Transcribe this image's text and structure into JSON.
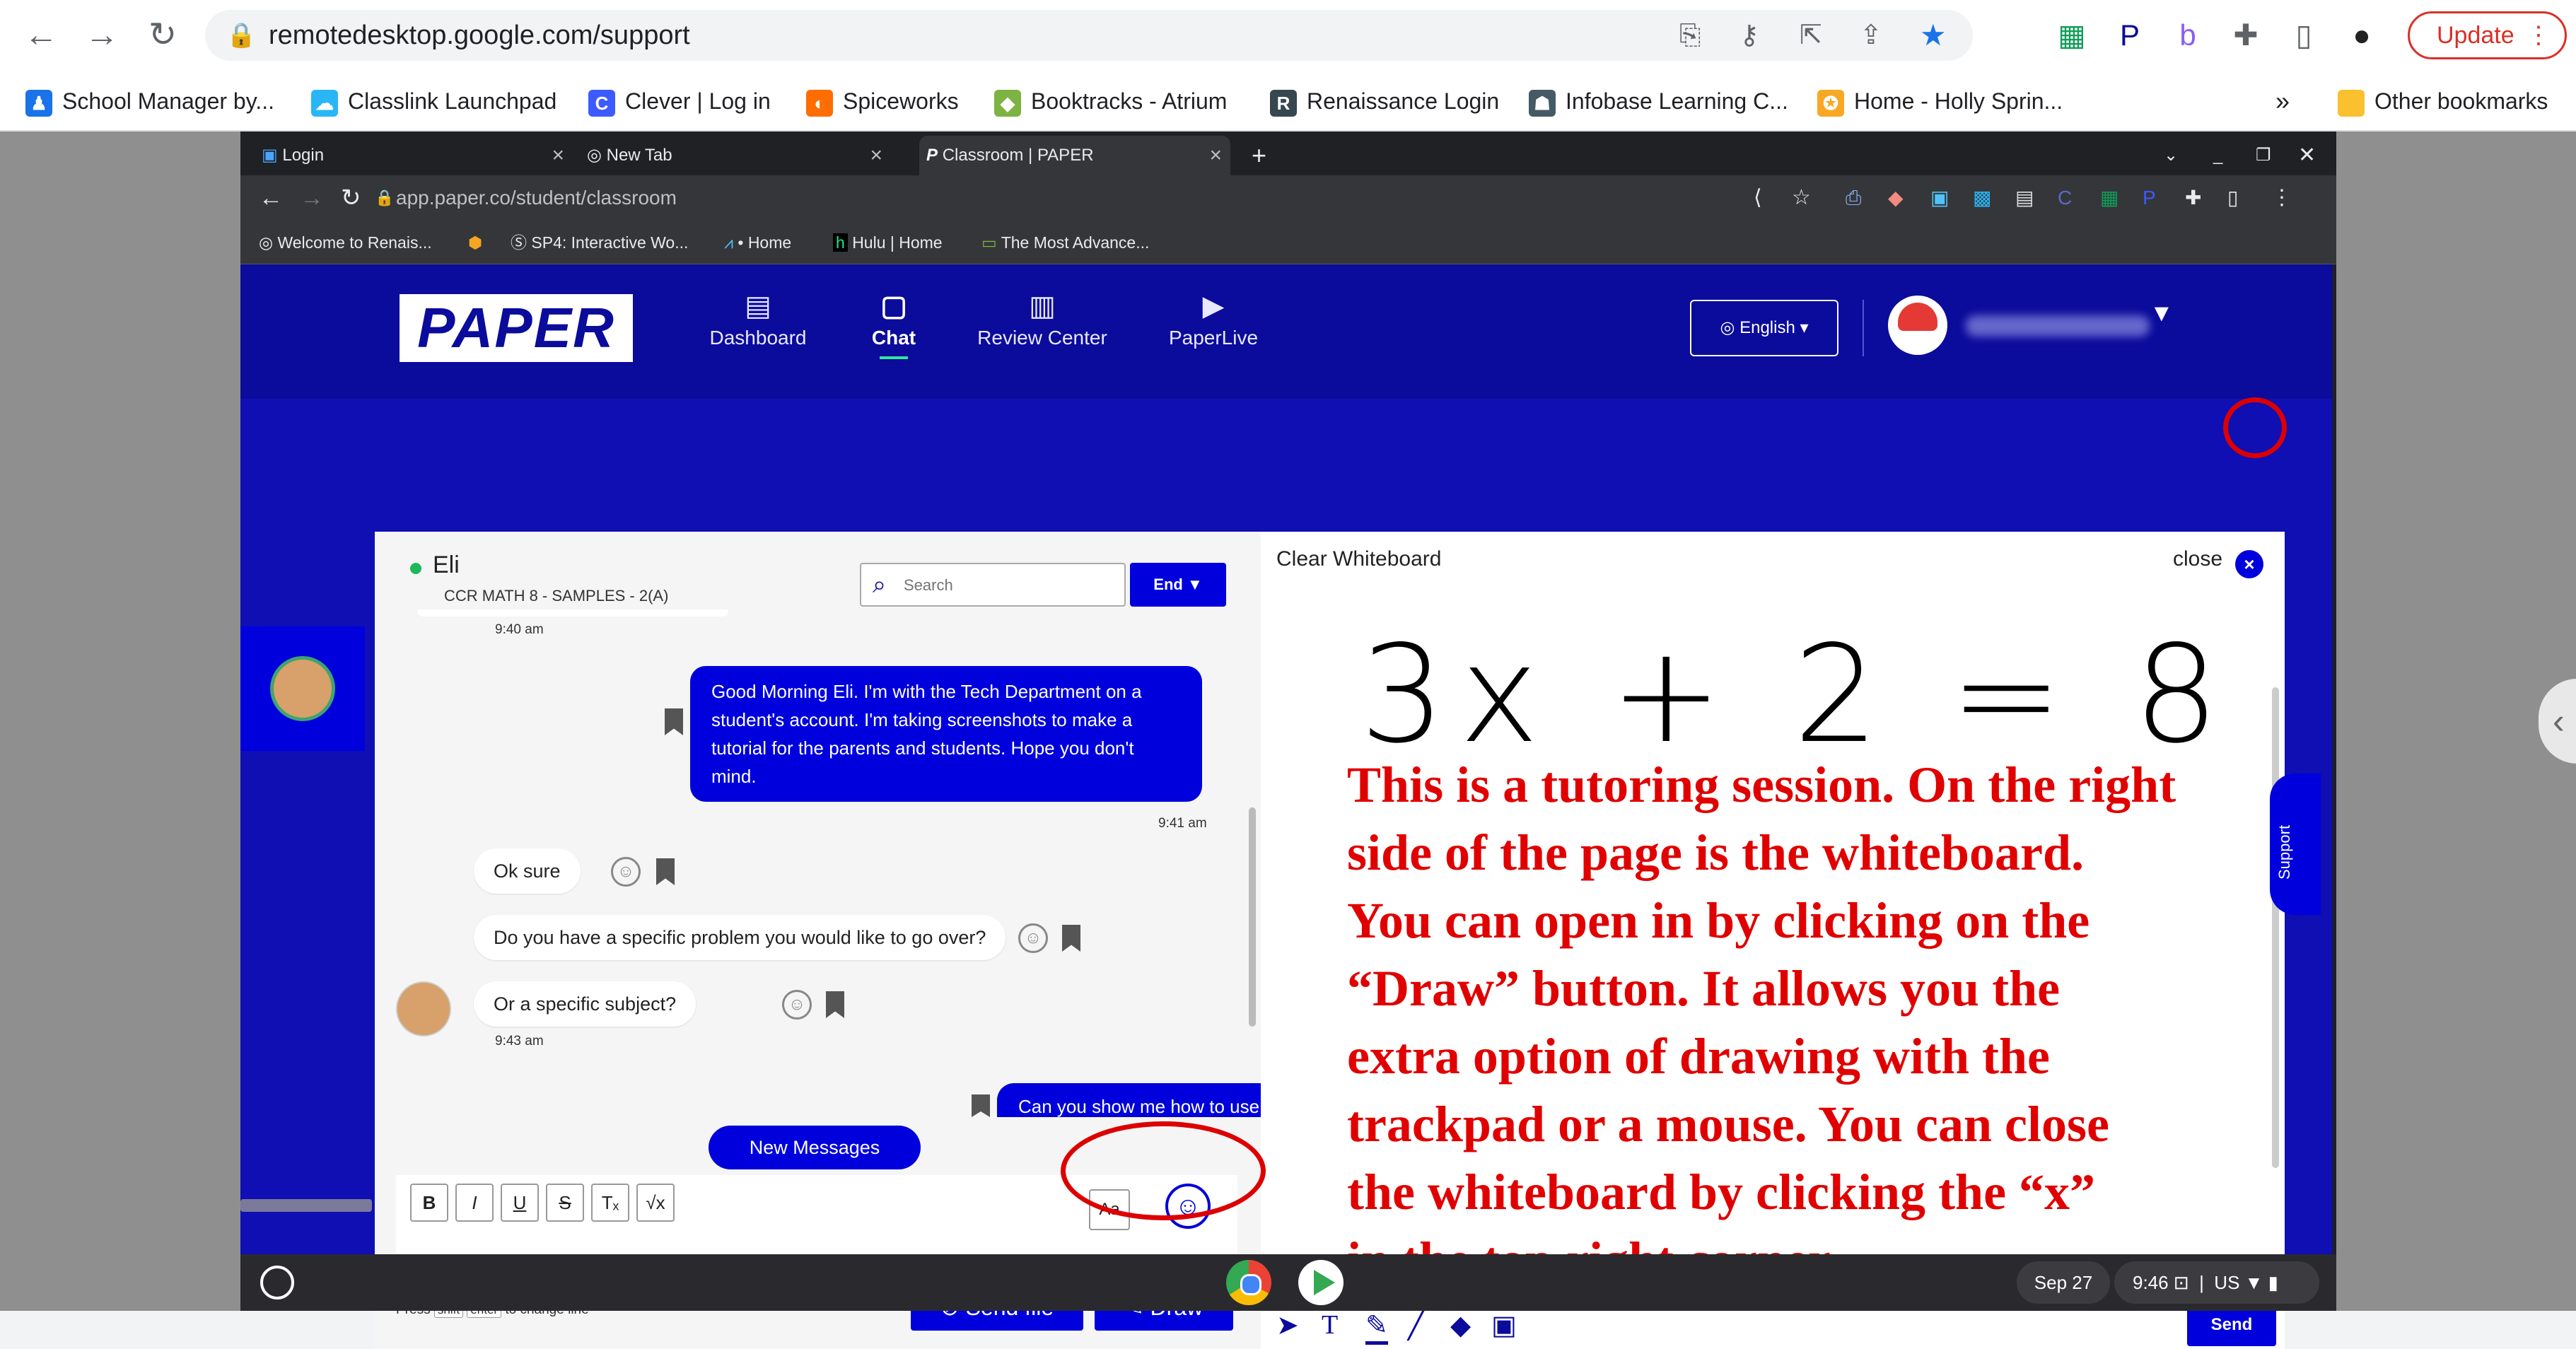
{
  "outer_browser": {
    "url": "remotedesktop.google.com/support",
    "update_label": "Update",
    "bookmarks": [
      "School Manager by...",
      "Classlink Launchpad",
      "Clever | Log in",
      "Spiceworks",
      "Booktracks - Atrium",
      "Renaissance Login",
      "Infobase Learning C...",
      "Home - Holly Sprin..."
    ],
    "more_bookmarks": "»",
    "other_bookmarks": "Other bookmarks"
  },
  "inner_browser": {
    "tabs": [
      {
        "label": "Login"
      },
      {
        "label": "New Tab"
      },
      {
        "label": "Classroom | PAPER"
      }
    ],
    "new_tab": "+",
    "url": "app.paper.co/student/classroom",
    "bookmarks": [
      "Welcome to Renais...",
      "SP4: Interactive Wo...",
      "• Home",
      "Hulu | Home",
      "The Most Advance..."
    ]
  },
  "paper_nav": {
    "logo": "PAPER",
    "items": [
      {
        "label": "Dashboard"
      },
      {
        "label": "Chat"
      },
      {
        "label": "Review Center"
      },
      {
        "label": "PaperLive"
      }
    ],
    "language": "English"
  },
  "chat": {
    "contact_name": "Eli",
    "class_name": "CCR MATH 8 - SAMPLES - 2(A)",
    "search_placeholder": "Search",
    "end_label": "End",
    "messages": [
      {
        "time": "9:40 am"
      },
      {
        "text": "Good Morning Eli. I'm with the Tech Department on a student's account. I'm taking screenshots to make a tutorial for the parents and students. Hope you don't mind.",
        "time": "9:41 am"
      },
      {
        "text": "Ok sure"
      },
      {
        "text": "Do you have a specific problem you would like to go over?"
      },
      {
        "text": "Or a specific subject?",
        "time": "9:43 am"
      },
      {
        "text": "Can you show me how to use the whiteboard?"
      }
    ],
    "new_messages_label": "New Messages",
    "format_buttons": [
      "B",
      "I",
      "U",
      "S",
      "Tₓ",
      "√x"
    ],
    "aa_label": "Aa",
    "press_hint": {
      "pre": "Press",
      "key1": "shift",
      "key2": "enter",
      "post": "to change line"
    },
    "send_file_label": "Send file",
    "draw_label": "Draw"
  },
  "whiteboard": {
    "clear_label": "Clear Whiteboard",
    "close_label": "close",
    "equation": "3x + 2 = 8",
    "note_lines": [
      "This is a tutoring session. On the right",
      "side of the page is the whiteboard.",
      "You can open in by clicking on the",
      "“Draw” button. It allows you the",
      "extra option of drawing with the",
      "trackpad or a mouse. You can close",
      "the whiteboard by clicking the “x”",
      "in the top right corner."
    ],
    "send_label": "Send",
    "support_label": "Support"
  },
  "shelf": {
    "date": "Sep 27",
    "time": "9:46",
    "locale": "US"
  }
}
